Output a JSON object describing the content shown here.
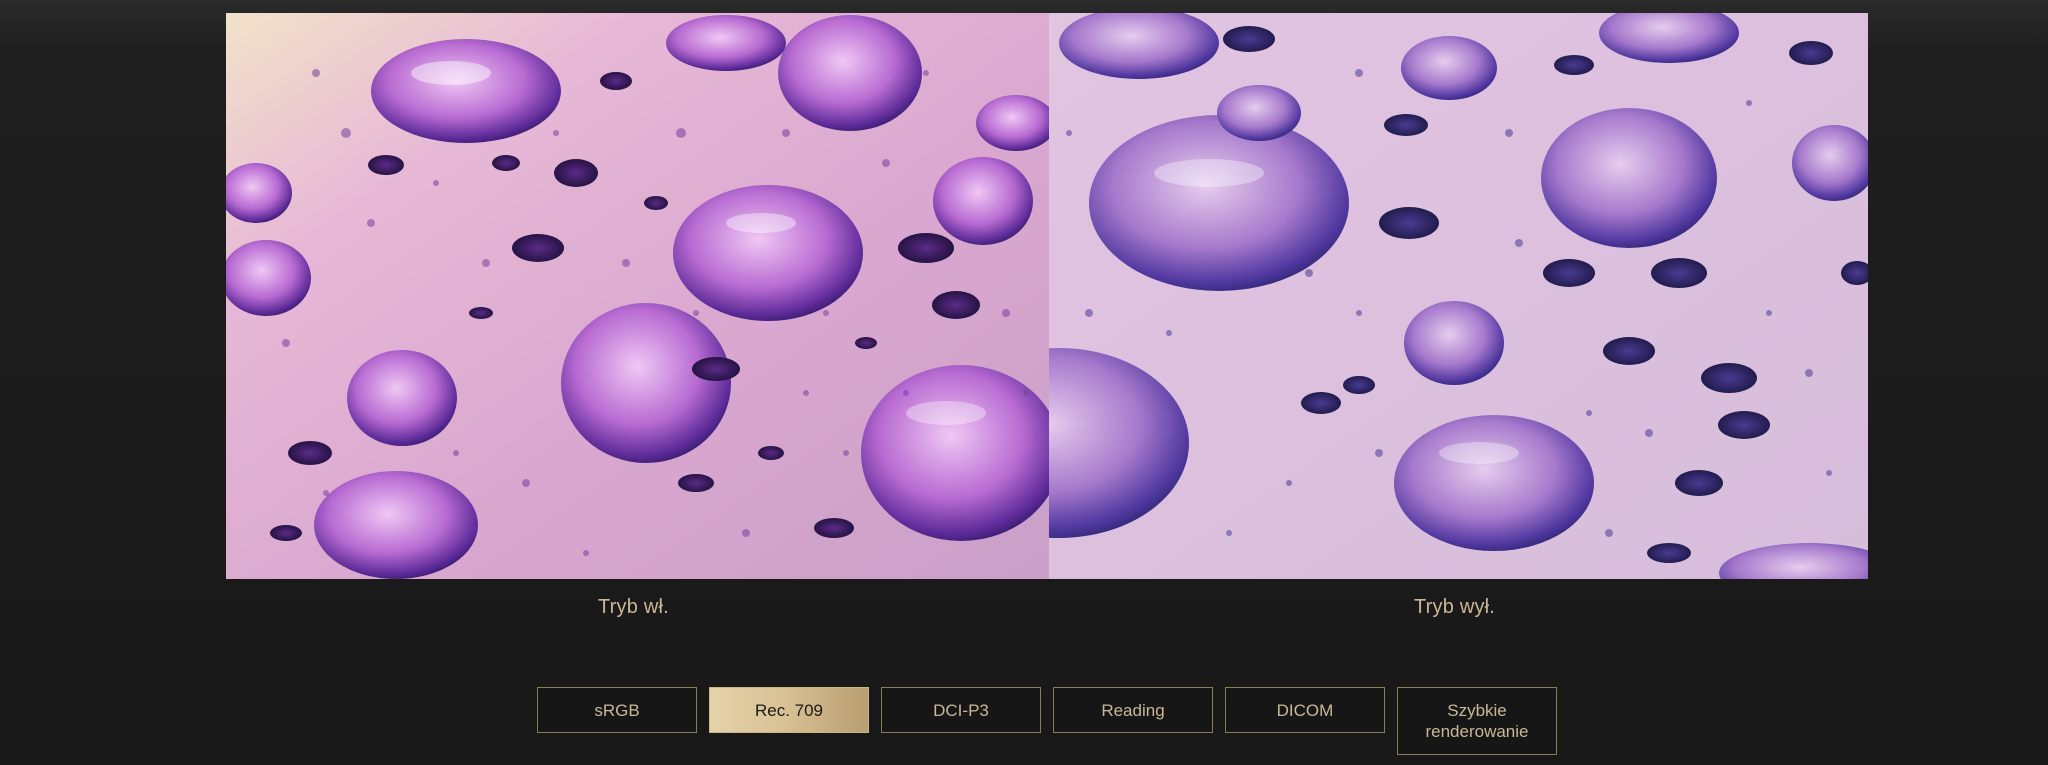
{
  "comparison": {
    "left_caption": "Tryb wł.",
    "right_caption": "Tryb wył."
  },
  "modes": [
    {
      "label": "sRGB",
      "active": false
    },
    {
      "label": "Rec. 709",
      "active": true
    },
    {
      "label": "DCI-P3",
      "active": false
    },
    {
      "label": "Reading",
      "active": false
    },
    {
      "label": "DICOM",
      "active": false
    },
    {
      "label": "Szybkie renderowanie",
      "active": false
    }
  ],
  "colors": {
    "accent_gold": "#c9b896",
    "active_gold": "#d9c296",
    "background": "#1a1a1a"
  }
}
